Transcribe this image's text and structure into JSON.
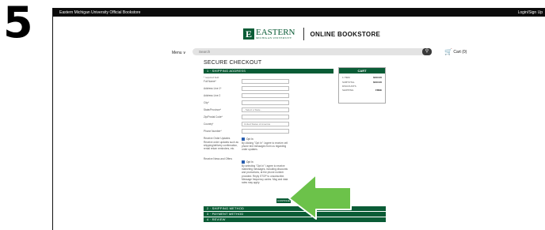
{
  "step": "5",
  "topbar": {
    "title": "Eastern Michigan University Official Bookstore",
    "login": "Login/Sign Up"
  },
  "logo": {
    "word": "EASTERN",
    "sub": "MICHIGAN UNIVERSITY",
    "store": "ONLINE BOOKSTORE"
  },
  "nav": {
    "menu": "Menu ∨",
    "search_placeholder": "Search",
    "cart": "Cart (0)"
  },
  "checkout": {
    "heading": "SECURE CHECKOUT",
    "section1": "1 · SHIPPING ADDRESS",
    "required_note": "* required field",
    "fields": [
      {
        "label": "Full Name*",
        "value": ""
      },
      {
        "label": "Address Line 1*",
        "value": ""
      },
      {
        "label": "Address Line 2",
        "value": ""
      },
      {
        "label": "City*",
        "value": ""
      },
      {
        "label": "State/Province*",
        "value": "- Select a State -"
      },
      {
        "label": "Zip/Postal Code*",
        "value": ""
      },
      {
        "label": "Country*",
        "value": "United States of America"
      },
      {
        "label": "Phone Number*",
        "value": ""
      }
    ],
    "order_updates": {
      "label": "Receive Order Updates",
      "note": "Receive order updates such as shipping/delivery confirmation, rental return reminders, etc.",
      "opt_in": "Opt In",
      "text": "By clicking \"Opt In\" I agree to receive cell phone text messages from us regarding order updates."
    },
    "news_offers": {
      "label": "Receive News and Offers",
      "opt_in": "Opt In",
      "text": "By selecting \"Opt In\" I agree to receive marketing messages, including discounts and promotions, at the phone number provided. Reply STOP to unsubscribe. Message frequency varies. Msg and data rates may apply."
    },
    "continue": "CONTINUE",
    "section2": "2 · SHIPPING METHOD",
    "section3": "3 · PAYMENT METHOD",
    "section4": "4 · REVIEW"
  },
  "cart": {
    "title": "CART",
    "lines": [
      {
        "label": "1 ITEM",
        "value": "$103.00"
      },
      {
        "label": "SUBTOTAL",
        "value": "$103.00"
      },
      {
        "label": "DISCOUNTS",
        "value": ""
      },
      {
        "label": "SHIPPING",
        "value": "FREE"
      }
    ]
  },
  "colors": {
    "brand_green": "#0a5c36",
    "arrow_green": "#6cc24a"
  }
}
